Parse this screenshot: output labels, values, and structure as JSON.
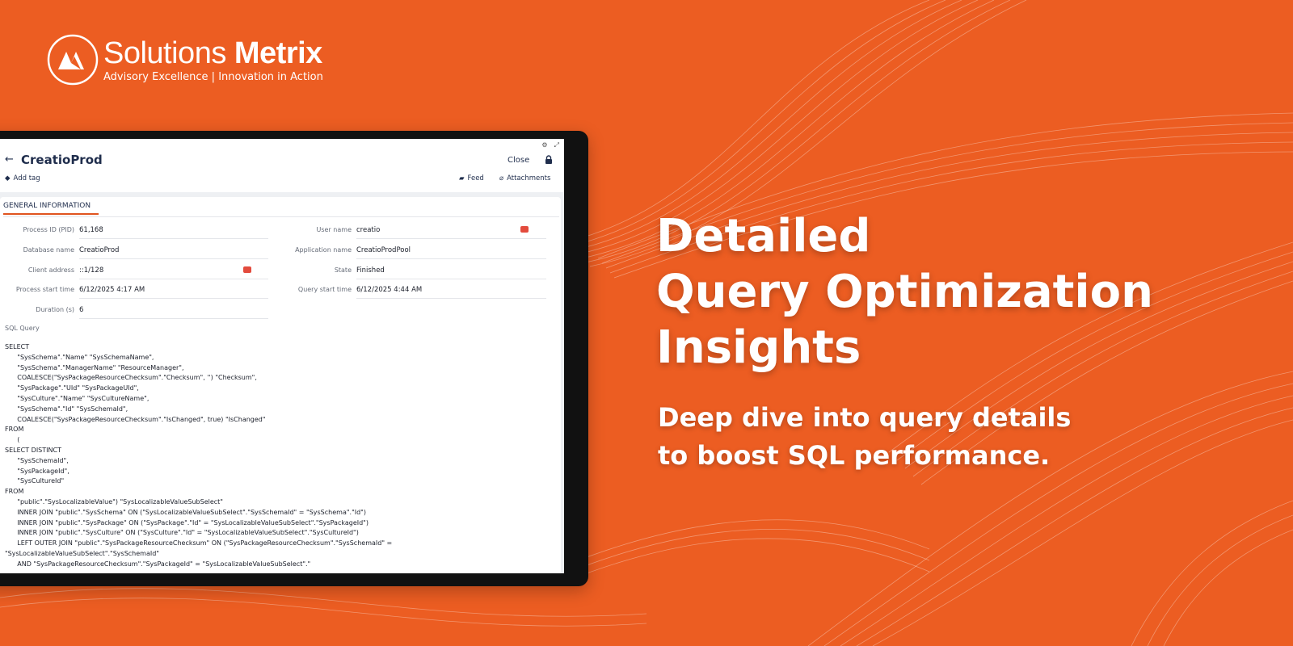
{
  "brand": {
    "name_light": "Solutions",
    "name_bold": "Metrix",
    "tagline": "Advisory Excellence | Innovation in Action"
  },
  "record": {
    "title": "CreatioProd",
    "close_label": "Close",
    "add_tag_label": "Add tag",
    "feed_label": "Feed",
    "attachments_label": "Attachments",
    "tab_label": "GENERAL INFORMATION"
  },
  "fields": {
    "pid_label": "Process ID (PID)",
    "pid_value": "61,168",
    "db_label": "Database name",
    "db_value": "CreatioProd",
    "client_label": "Client address",
    "client_value": "::1/128",
    "pstart_label": "Process start time",
    "pstart_value": "6/12/2025 4:17 AM",
    "duration_label": "Duration (s)",
    "duration_value": "6",
    "user_label": "User name",
    "user_value": "creatio",
    "app_label": "Application name",
    "app_value": "CreatioProdPool",
    "state_label": "State",
    "state_value": "Finished",
    "qstart_label": "Query start time",
    "qstart_value": "6/12/2025 4:44 AM"
  },
  "sql": {
    "label": "SQL Query",
    "lines": [
      "SELECT",
      "      \"SysSchema\".\"Name\" \"SysSchemaName\",",
      "      \"SysSchema\".\"ManagerName\" \"ResourceManager\",",
      "      COALESCE(\"SysPackageResourceChecksum\".\"Checksum\", '') \"Checksum\",",
      "      \"SysPackage\".\"UId\" \"SysPackageUId\",",
      "      \"SysCulture\".\"Name\" \"SysCultureName\",",
      "      \"SysSchema\".\"Id\" \"SysSchemaId\",",
      "      COALESCE(\"SysPackageResourceChecksum\".\"IsChanged\", true) \"IsChanged\"",
      "FROM",
      "      (",
      "SELECT DISTINCT",
      "      \"SysSchemaId\",",
      "      \"SysPackageId\",",
      "      \"SysCultureId\"",
      "FROM",
      "      \"public\".\"SysLocalizableValue\") \"SysLocalizableValueSubSelect\"",
      "      INNER JOIN \"public\".\"SysSchema\" ON (\"SysLocalizableValueSubSelect\".\"SysSchemaId\" = \"SysSchema\".\"Id\")",
      "      INNER JOIN \"public\".\"SysPackage\" ON (\"SysPackage\".\"Id\" = \"SysLocalizableValueSubSelect\".\"SysPackageId\")",
      "      INNER JOIN \"public\".\"SysCulture\" ON (\"SysCulture\".\"Id\" = \"SysLocalizableValueSubSelect\".\"SysCultureId\")",
      "      LEFT OUTER JOIN \"public\".\"SysPackageResourceChecksum\" ON (\"SysPackageResourceChecksum\".\"SysSchemaId\" =",
      "\"SysLocalizableValueSubSelect\".\"SysSchemaId\"",
      "      AND \"SysPackageResourceChecksum\".\"SysPackageId\" = \"SysLocalizableValueSubSelect\".\""
    ]
  },
  "hero": {
    "title_lines": [
      "Detailed",
      "Query Optimization",
      "Insights"
    ],
    "subtitle_lines": [
      "Deep dive into query details",
      "to boost SQL performance."
    ]
  },
  "colors": {
    "background": "#ec5d22",
    "accent": "#e0541f",
    "text_dark": "#1f2d4c"
  },
  "icons": [
    "brand-logo-icon",
    "back-arrow-icon",
    "lock-icon",
    "tag-icon",
    "feed-icon",
    "paperclip-icon",
    "settings-icon",
    "expand-icon",
    "copy-icon"
  ]
}
